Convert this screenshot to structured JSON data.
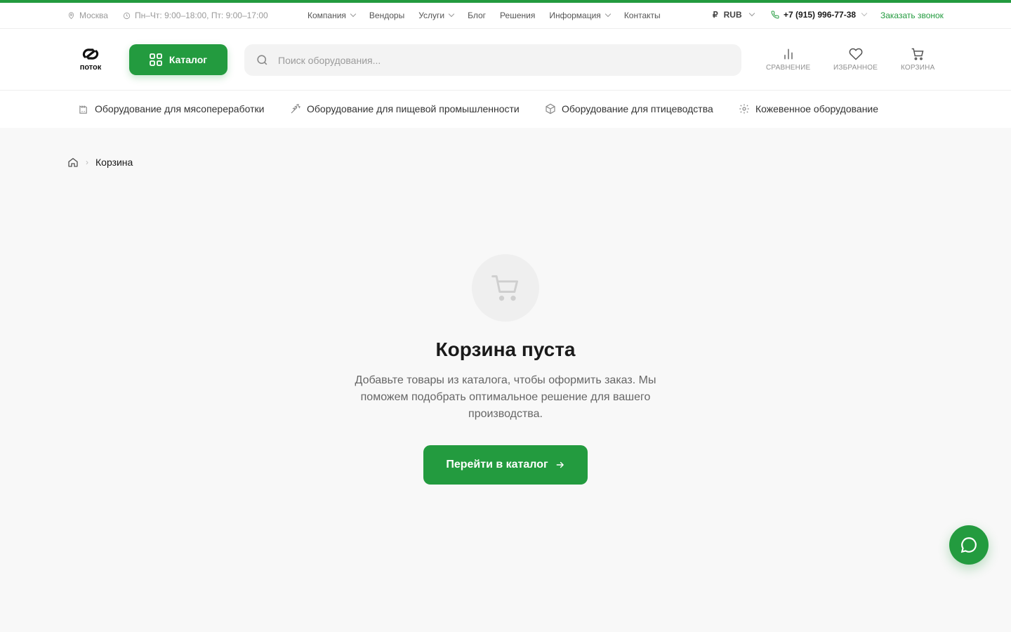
{
  "colors": {
    "accent": "#239b3f",
    "background": "#f8f8f8",
    "muted": "#9a9a9a"
  },
  "topbar": {
    "city": "Москва",
    "hours": "Пн–Чт: 9:00–18:00, Пт: 9:00–17:00",
    "nav": [
      {
        "label": "Компания",
        "dropdown": true
      },
      {
        "label": "Вендоры",
        "dropdown": false
      },
      {
        "label": "Услуги",
        "dropdown": true
      },
      {
        "label": "Блог",
        "dropdown": false
      },
      {
        "label": "Решения",
        "dropdown": false
      },
      {
        "label": "Информация",
        "dropdown": true
      },
      {
        "label": "Контакты",
        "dropdown": false
      }
    ],
    "currency_symbol": "₽",
    "currency": "RUB",
    "phone": "+7 (915) 996-77-38",
    "callback": "Заказать звонок"
  },
  "header": {
    "logo_text": "поток",
    "catalog_label": "Каталог",
    "search_placeholder": "Поиск оборудования...",
    "actions": {
      "compare": "СРАВНЕНИЕ",
      "favorites": "ИЗБРАННОЕ",
      "cart": "КОРЗИНА"
    }
  },
  "categories": [
    {
      "label": "Оборудование для мясопереработки",
      "icon": "factory-icon"
    },
    {
      "label": "Оборудование для пищевой промышленности",
      "icon": "wheat-icon"
    },
    {
      "label": "Оборудование для птицеводства",
      "icon": "box-icon"
    },
    {
      "label": "Кожевенное оборудование",
      "icon": "gear-icon"
    }
  ],
  "breadcrumb": {
    "current": "Корзина"
  },
  "empty": {
    "title": "Корзина пуста",
    "text": "Добавьте товары из каталога, чтобы оформить заказ. Мы поможем подобрать оптимальное решение для вашего производства.",
    "button": "Перейти в каталог"
  }
}
